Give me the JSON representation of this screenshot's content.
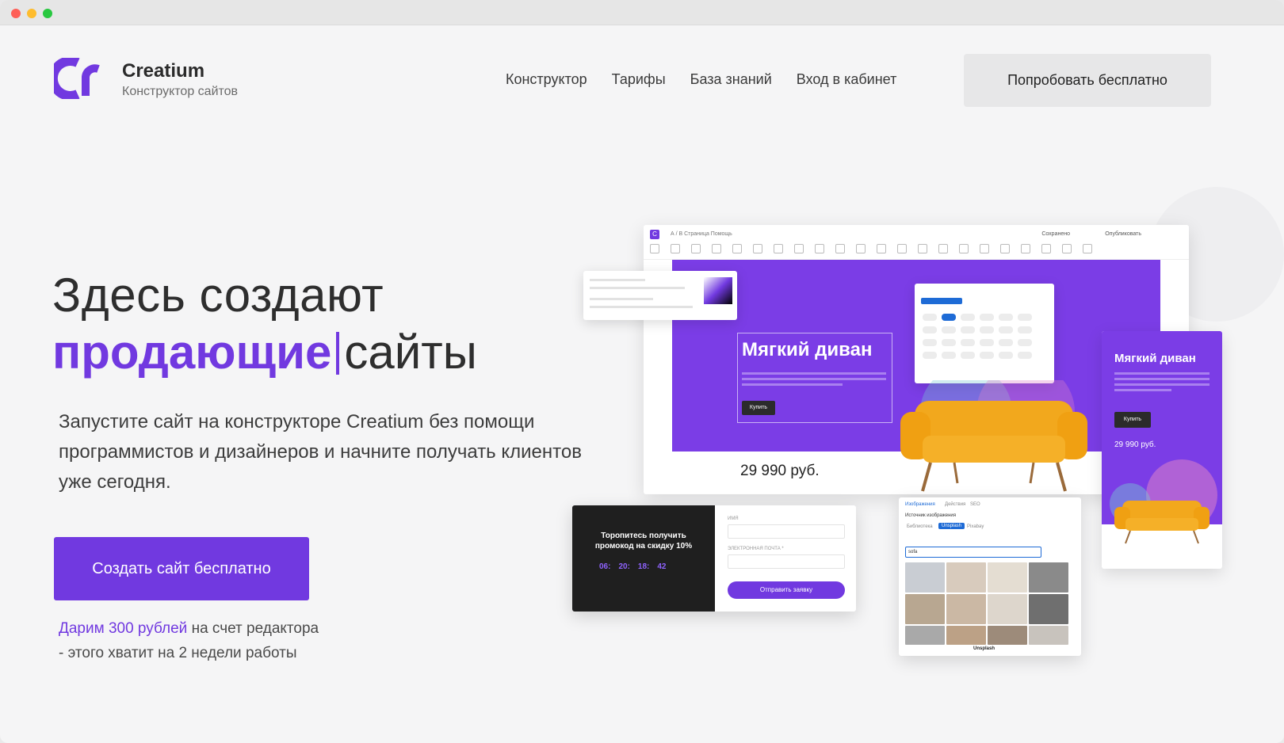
{
  "brand": {
    "name": "Creatium",
    "tagline": "Конструктор сайтов",
    "accent": "#7139e0"
  },
  "nav": {
    "items": [
      "Конструктор",
      "Тарифы",
      "База знаний",
      "Вход в кабинет"
    ],
    "cta": "Попробовать бесплатно"
  },
  "hero": {
    "line1": "Здесь создают",
    "line2_accent": "продающие",
    "line2_rest": "сайты",
    "description": "Запустите сайт на конструкторе Creatium без помощи программистов и дизайнеров и начните получать клиентов уже сегодня.",
    "cta": "Создать сайт бесплатно",
    "gift_highlight": "Дарим 300 рублей",
    "gift_rest": "на счет редактора",
    "gift_line2": "- этого хватит на 2 недели работы"
  },
  "mockup": {
    "editor_save": "Сохранено",
    "editor_publish": "Опубликовать",
    "editor_pages": "А / В   Страница   Помощь",
    "product_title": "Мягкий диван",
    "product_buy": "Купить",
    "product_price": "29 990 руб.",
    "mobile_title": "Мягкий диван",
    "mobile_buy": "Купить",
    "mobile_price": "29 990 руб.",
    "promo_text": "Торопитесь получить промокод на скидку 10%",
    "timer": [
      "06:",
      "20:",
      "18:",
      "42"
    ],
    "form_name_label": "ИМЯ",
    "form_email_label": "ЭЛЕКТРОННАЯ ПОЧТА *",
    "form_submit": "Отправить заявку",
    "image_tabs": [
      "Изображения",
      "Действия",
      "SEO"
    ],
    "image_source_label": "Источник изображения",
    "image_sources": [
      "Библиотека",
      "Unsplash",
      "Pixabay"
    ],
    "image_search_value": "sofa",
    "image_credit": "Unsplash"
  }
}
